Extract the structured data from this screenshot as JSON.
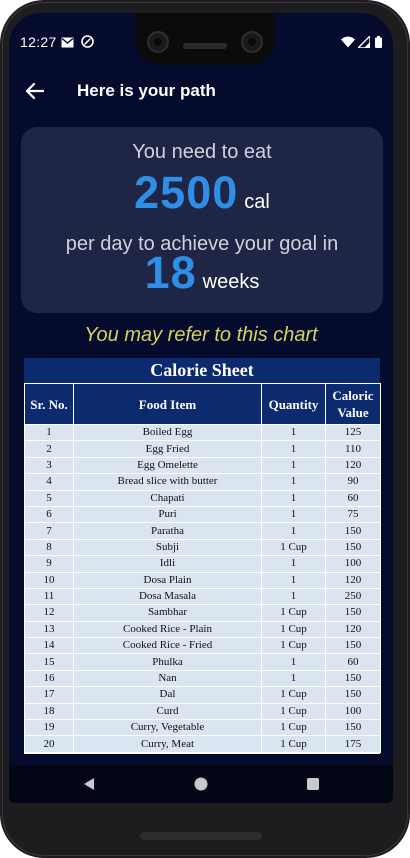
{
  "status_bar": {
    "time": "12:27",
    "icons": [
      "mail-icon",
      "at-sign-icon",
      "wifi-icon",
      "cell-signal-icon",
      "battery-icon"
    ]
  },
  "app_bar": {
    "title": "Here is your path",
    "back_icon": "arrow-left-icon"
  },
  "summary": {
    "line1": "You need to eat",
    "calories": "2500",
    "calories_unit": "cal",
    "line3": "per day to achieve your goal in",
    "weeks": "18",
    "weeks_unit": "weeks"
  },
  "refer_text": "You may refer to this chart",
  "calorie_sheet": {
    "title": "Calorie Sheet",
    "columns": [
      "Sr. No.",
      "Food Item",
      "Quantity",
      "Caloric Value"
    ],
    "rows": [
      [
        "1",
        "Boiled Egg",
        "1",
        "125"
      ],
      [
        "2",
        "Egg Fried",
        "1",
        "110"
      ],
      [
        "3",
        "Egg Omelette",
        "1",
        "120"
      ],
      [
        "4",
        "Bread slice with butter",
        "1",
        "90"
      ],
      [
        "5",
        "Chapati",
        "1",
        "60"
      ],
      [
        "6",
        "Puri",
        "1",
        "75"
      ],
      [
        "7",
        "Paratha",
        "1",
        "150"
      ],
      [
        "8",
        "Subji",
        "1 Cup",
        "150"
      ],
      [
        "9",
        "Idli",
        "1",
        "100"
      ],
      [
        "10",
        "Dosa Plain",
        "1",
        "120"
      ],
      [
        "11",
        "Dosa Masala",
        "1",
        "250"
      ],
      [
        "12",
        "Sambhar",
        "1  Cup",
        "150"
      ],
      [
        "13",
        "Cooked Rice - Plain",
        "1  Cup",
        "120"
      ],
      [
        "14",
        "Cooked Rice - Fried",
        "1  Cup",
        "150"
      ],
      [
        "15",
        "Phulka",
        "1",
        "60"
      ],
      [
        "16",
        "Nan",
        "1",
        "150"
      ],
      [
        "17",
        "Dal",
        "1 Cup",
        "150"
      ],
      [
        "18",
        "Curd",
        "1 Cup",
        "100"
      ],
      [
        "19",
        "Curry, Vegetable",
        "1 Cup",
        "150"
      ],
      [
        "20",
        "Curry, Meat",
        "1 Cup",
        "175"
      ]
    ]
  },
  "nav_bar": {
    "buttons": [
      "back-triangle-icon",
      "home-circle-icon",
      "recents-square-icon"
    ]
  },
  "colors": {
    "screen_bg": "#040b2d",
    "card_bg": "#1e2545",
    "accent_blue": "#2f8fe6",
    "refer_yellow": "#d6cf62",
    "table_header": "#0c2a6e",
    "table_cell": "#dbe4f1"
  }
}
